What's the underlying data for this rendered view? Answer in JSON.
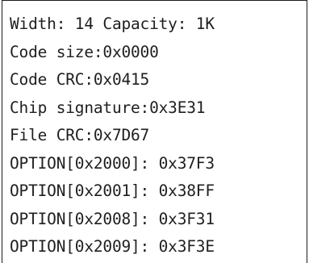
{
  "output": {
    "lines": [
      "Width: 14 Capacity: 1K",
      "Code size:0x0000",
      "Code CRC:0x0415",
      "Chip signature:0x3E31",
      "File CRC:0x7D67",
      "OPTION[0x2000]: 0x37F3",
      "OPTION[0x2001]: 0x38FF",
      "OPTION[0x2008]: 0x3F31",
      "OPTION[0x2009]: 0x3F3E"
    ]
  }
}
